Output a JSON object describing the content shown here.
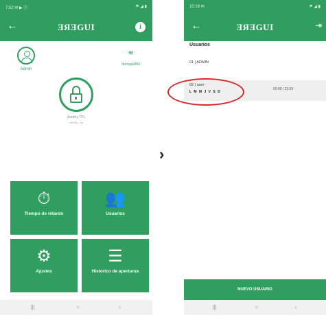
{
  "left_screen": {
    "status_left": "7:52 ✉ ▶ ⓢ",
    "status_right": "⚑ ◢ ▮",
    "brand": "ƎЯƎGUI",
    "profile_name": "Admin",
    "wifi_name": "Iturregui984",
    "device_name": "Jostery TPL",
    "device_sub": "a4e5dc_aa",
    "tiles": [
      {
        "label": "Tiempo de retardo",
        "icon": "timer-card-icon",
        "glyph": "⏱"
      },
      {
        "label": "Usuarios",
        "icon": "users-icon",
        "glyph": "👥"
      },
      {
        "label": "Ajustes",
        "icon": "gear-icon",
        "glyph": "⚙"
      },
      {
        "label": "Historico de aperturas",
        "icon": "list-icon",
        "glyph": "☰"
      }
    ]
  },
  "right_screen": {
    "status_left": "10:19 ✉",
    "status_right": "⚑ ◢ ▮",
    "brand": "ƎЯƎGUI",
    "section_title": "Usuarios",
    "users": [
      {
        "name": "01 | ADMIN"
      },
      {
        "name": "02 | user",
        "days": "L M M J V S D",
        "time": "00:00 | 23:59"
      }
    ],
    "new_user_button": "NUEVO USUARIO"
  },
  "navbar": {
    "recent": "|||",
    "home": "○",
    "back": "‹"
  },
  "colors": {
    "accent": "#2f9e5f",
    "highlight": "#d8232a"
  }
}
